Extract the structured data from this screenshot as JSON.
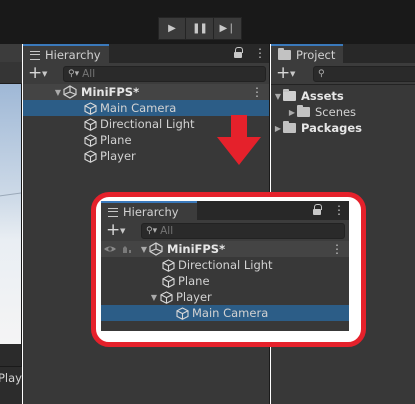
{
  "toolbar": {
    "play_icon": "play-icon",
    "pause_icon": "pause-icon",
    "step_icon": "step-icon"
  },
  "scene_strip": {
    "game_tab_label": "Play"
  },
  "hierarchy": {
    "tab_label": "Hierarchy",
    "search_placeholder": "All",
    "scene": "MiniFPS*",
    "items": [
      "Main Camera",
      "Directional Light",
      "Plane",
      "Player"
    ]
  },
  "project": {
    "tab_label": "Project",
    "root_folder": "Assets",
    "sub_folder": "Scenes",
    "packages_folder": "Packages"
  },
  "inset_hierarchy": {
    "tab_label": "Hierarchy",
    "search_placeholder": "All",
    "scene": "MiniFPS*",
    "items": [
      "Directional Light",
      "Plane",
      "Player"
    ],
    "child_item": "Main Camera"
  },
  "annotation": {
    "arrow_color": "#e5212b",
    "frame_color": "#e5212b"
  },
  "colors": {
    "selection": "#2c5d87",
    "panel": "#383838",
    "tab_accent": "#3a79bb"
  }
}
